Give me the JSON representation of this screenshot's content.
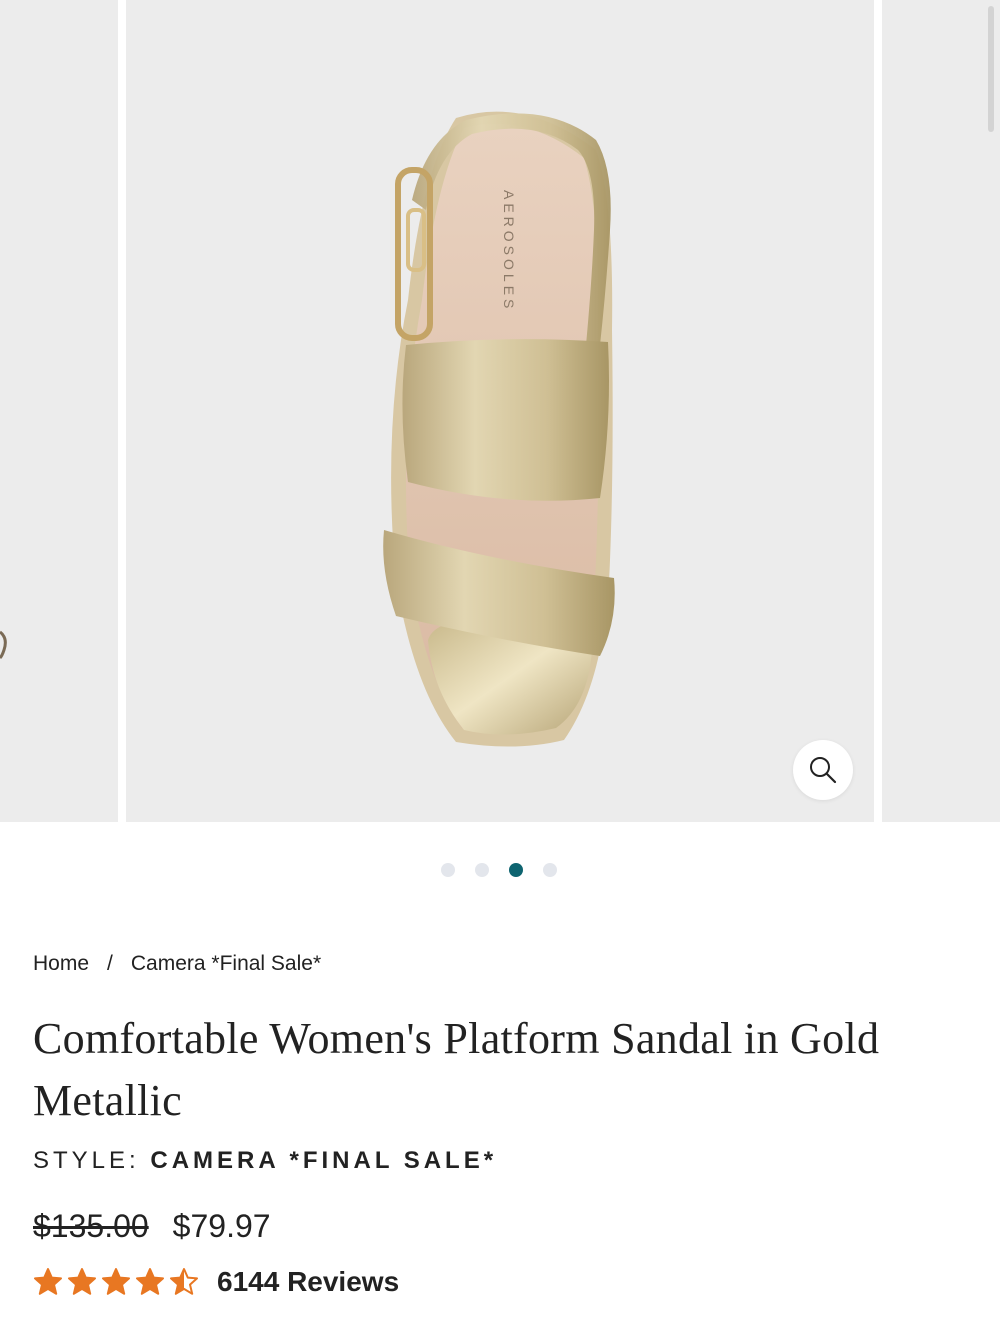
{
  "gallery": {
    "active_index": 2,
    "dot_count": 4,
    "brand_imprint": "AEROSOLES",
    "zoom_icon": "search-icon"
  },
  "breadcrumb": {
    "home": "Home",
    "separator": "/",
    "current": "Camera *Final Sale*"
  },
  "product": {
    "title": "Comfortable Women's Platform Sandal in Gold Metallic",
    "style_label": "STYLE:",
    "style_value": "CAMERA *FINAL SALE*",
    "price_original": "$135.00",
    "price_sale": "$79.97",
    "rating": 4.5,
    "rating_max": 5,
    "reviews": "6144 Reviews"
  },
  "colors": {
    "accent": "#0e6470",
    "star": "#e87722",
    "image_bg": "#ececec"
  }
}
